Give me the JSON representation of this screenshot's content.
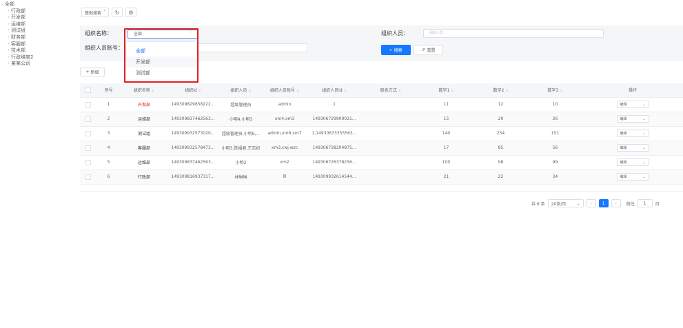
{
  "tree": {
    "root": "全部",
    "children": [
      "行政部",
      "开发部",
      "运维部",
      "测试组",
      "财务部",
      "客服部",
      "技术部",
      "行政维度2",
      "某某公司"
    ]
  },
  "toolbar": {
    "advanced_search": "基础搜索",
    "refresh_icon": "refresh-icon",
    "settings_icon": "gear-icon"
  },
  "filters": {
    "org_name_label": "组织名称：",
    "org_name_value": "全部",
    "org_member_label": "组织人员：",
    "org_member_placeholder": "组织人员",
    "org_member_account_label": "组织人员账号：",
    "org_member_account_placeholder": ""
  },
  "dropdown": {
    "options": [
      "全部",
      "开发部",
      "测试部"
    ],
    "selected": "全部"
  },
  "buttons": {
    "search": "搜索",
    "reset": "重置",
    "add": "新增"
  },
  "table": {
    "headers": [
      "序号",
      "组织名称",
      "组织id",
      "组织人员",
      "组织人员账号",
      "组织人员id",
      "联系方式",
      "数字1",
      "数字2",
      "数字3",
      "操作"
    ],
    "rows": [
      {
        "no": "1",
        "name": "开发部",
        "org_id": "149309829658222...",
        "members": "超级管理员",
        "accounts": "admin",
        "member_ids": "1",
        "contact": "",
        "n1": "11",
        "n2": "12",
        "n3": "10",
        "op": "编辑"
      },
      {
        "no": "2",
        "name": "运维部",
        "org_id": "149309837462563...",
        "members": "小明4,小明3",
        "accounts": "xm4,xm3",
        "member_ids": "149306729909021...",
        "contact": "",
        "n1": "15",
        "n2": "20",
        "n3": "26",
        "op": "编辑"
      },
      {
        "no": "3",
        "name": "测试组",
        "org_id": "149309932573020...",
        "members": "超级管理员,小明6,...",
        "accounts": "admin,xm6,xm7",
        "member_ids": "1,14930673355563...",
        "contact": "",
        "n1": "140",
        "n2": "254",
        "n3": "151",
        "op": "编辑"
      },
      {
        "no": "4",
        "name": "客服部",
        "org_id": "149309932578473...",
        "members": "小明3,陈娟君,王志初",
        "accounts": "xm3,cwj,wzc",
        "member_ids": "149306728204875...",
        "contact": "",
        "n1": "17",
        "n2": "85",
        "n3": "56",
        "op": "编辑"
      },
      {
        "no": "5",
        "name": "运维部",
        "org_id": "149309837462563...",
        "members": "小明2",
        "accounts": "xm2",
        "member_ids": "149306726378256...",
        "contact": "",
        "n1": "100",
        "n2": "98",
        "n3": "99",
        "op": "编辑"
      },
      {
        "no": "6",
        "name": "行政部",
        "org_id": "149309816937317...",
        "members": "林琳琳",
        "accounts": "lll",
        "member_ids": "149309932614544...",
        "contact": "",
        "n1": "21",
        "n2": "22",
        "n3": "34",
        "op": "编辑"
      }
    ]
  },
  "pagination": {
    "total": "共 6 条",
    "page_size": "20条/页",
    "current_page": "1",
    "goto_label": "前往",
    "goto_value": "1",
    "page_suffix": "页"
  },
  "colors": {
    "primary": "#1677ff",
    "highlight_frame": "#e02020",
    "panel_bg": "#f5f6f8"
  }
}
